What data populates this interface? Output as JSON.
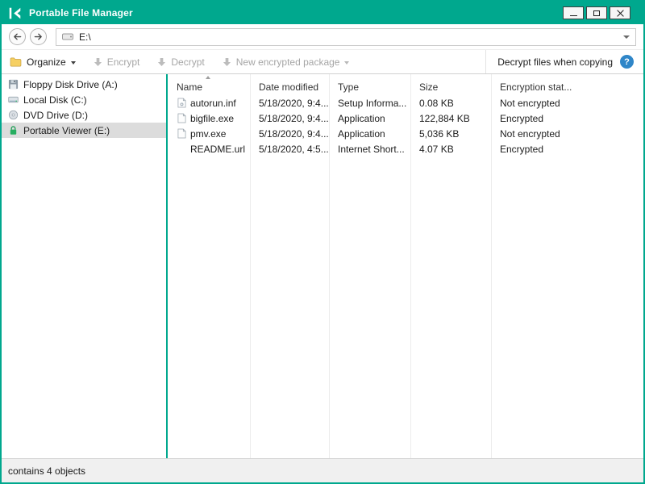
{
  "colors": {
    "accent_teal": "#00a88e",
    "help_blue": "#2f86c8",
    "folder_yellow": "#f6d063",
    "lock_green": "#27ae60",
    "disabled_text": "#a6a6a6",
    "selection_grey": "#dcdcdc"
  },
  "window": {
    "title": "Portable File Manager",
    "logo_icon": "kaspersky-logo",
    "controls": [
      "minimize",
      "maximize",
      "close"
    ]
  },
  "navigation": {
    "back_icon": "arrow-left-icon",
    "forward_icon": "arrow-right-icon",
    "address_drive_icon": "drive-icon",
    "address_value": "E:\\",
    "dropdown_icon": "chevron-down-icon"
  },
  "toolbar": {
    "organize_label": "Organize",
    "organize_icon": "folder-icon",
    "encrypt_label": "Encrypt",
    "decrypt_label": "Decrypt",
    "new_package_label": "New encrypted package",
    "action_icon": "down-arrow-icon",
    "decrypt_copy_label": "Decrypt files when copying",
    "help_glyph": "?"
  },
  "sidebar": {
    "items": [
      {
        "label": "Floppy Disk Drive (A:)",
        "icon": "floppy-drive-icon",
        "selected": false
      },
      {
        "label": "Local Disk (C:)",
        "icon": "hard-disk-icon",
        "selected": false
      },
      {
        "label": "DVD Drive (D:)",
        "icon": "dvd-drive-icon",
        "selected": false
      },
      {
        "label": "Portable Viewer (E:)",
        "icon": "lock-icon",
        "selected": true
      }
    ]
  },
  "file_list": {
    "columns": [
      {
        "label": "Name",
        "sorted": "asc"
      },
      {
        "label": "Date modified"
      },
      {
        "label": "Type"
      },
      {
        "label": "Size"
      },
      {
        "label": "Encryption stat..."
      }
    ],
    "rows": [
      {
        "icon": "setup-file-icon",
        "name": "autorun.inf",
        "date_modified": "5/18/2020, 9:4...",
        "type": "Setup Informa...",
        "size": "0.08 KB",
        "encryption": "Not encrypted"
      },
      {
        "icon": "application-file-icon",
        "name": "bigfile.exe",
        "date_modified": "5/18/2020, 9:4...",
        "type": "Application",
        "size": "122,884 KB",
        "encryption": "Encrypted"
      },
      {
        "icon": "application-file-icon",
        "name": "pmv.exe",
        "date_modified": "5/18/2020, 9:4...",
        "type": "Application",
        "size": "5,036 KB",
        "encryption": "Not encrypted"
      },
      {
        "icon": "none",
        "name": "README.url",
        "date_modified": "5/18/2020, 4:5...",
        "type": "Internet Short...",
        "size": "4.07 KB",
        "encryption": "Encrypted"
      }
    ]
  },
  "status_bar": {
    "text": "contains 4 objects"
  }
}
